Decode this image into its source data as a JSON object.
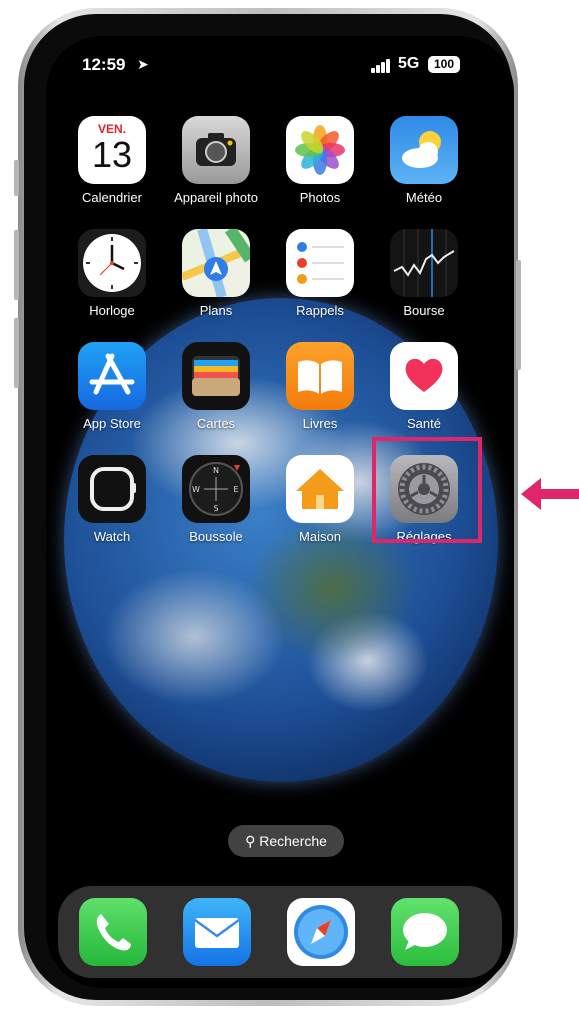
{
  "status_bar": {
    "time": "12:59",
    "network": "5G",
    "battery": "100"
  },
  "apps": [
    {
      "label": "Calendrier",
      "day": "VEN.",
      "date": "13"
    },
    {
      "label": "Appareil photo"
    },
    {
      "label": "Photos"
    },
    {
      "label": "Météo"
    },
    {
      "label": "Horloge"
    },
    {
      "label": "Plans"
    },
    {
      "label": "Rappels"
    },
    {
      "label": "Bourse"
    },
    {
      "label": "App Store"
    },
    {
      "label": "Cartes"
    },
    {
      "label": "Livres"
    },
    {
      "label": "Santé"
    },
    {
      "label": "Watch"
    },
    {
      "label": "Boussole"
    },
    {
      "label": "Maison"
    },
    {
      "label": "Réglages"
    }
  ],
  "search": {
    "label": "Recherche"
  },
  "colors": {
    "highlight": "#e0266a",
    "arrow": "#e0266a"
  }
}
